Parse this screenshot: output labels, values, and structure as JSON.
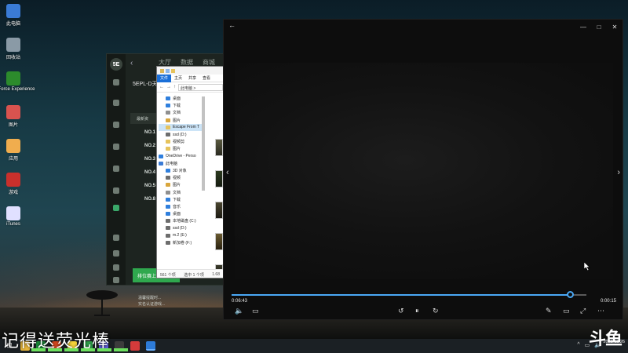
{
  "desktop": {
    "icons": [
      {
        "label": "此电脑",
        "icon": "computer-icon",
        "color": "#3a7bd5"
      },
      {
        "label": "回收站",
        "icon": "recycle-bin-icon",
        "color": "#8a9aa6"
      },
      {
        "label": "GeForce Experience",
        "icon": "nvidia-icon",
        "color": "#2c8b2c"
      },
      {
        "label": "图片",
        "icon": "pictures-folder-icon",
        "color": "#d9534f"
      },
      {
        "label": "应用",
        "icon": "apps-icon",
        "color": "#f0ad4e"
      },
      {
        "label": "游戏",
        "icon": "game-icon",
        "color": "#c9302c"
      },
      {
        "label": "iTunes",
        "icon": "itunes-icon",
        "color": "#e0e0ff"
      }
    ]
  },
  "game_client": {
    "logo": "5E",
    "tabs": [
      "大厅",
      "数据",
      "商城"
    ],
    "title": "5EPL-D天",
    "header_label": "最新资",
    "ranks": [
      "NO.1",
      "NO.2",
      "NO.3",
      "NO.4",
      "NO.5",
      "NO.8"
    ],
    "green_button": "排位赛上榜",
    "notice_lines": [
      "温馨提醒时...",
      "实名认证游戏..."
    ]
  },
  "explorer": {
    "ribbon_tabs": [
      "文件",
      "主页",
      "共享",
      "查看"
    ],
    "address": "此电脑 >",
    "nav_items": [
      {
        "label": "桌面",
        "icon_color": "#2f7fdd",
        "indent": true
      },
      {
        "label": "下载",
        "icon_color": "#2f7fdd",
        "indent": true
      },
      {
        "label": "文档",
        "icon_color": "#8f8f8f",
        "indent": true
      },
      {
        "label": "图片",
        "icon_color": "#d9a63c",
        "indent": true
      },
      {
        "label": "Escape From T",
        "icon_color": "#e6c35c",
        "indent": true,
        "selected": true
      },
      {
        "label": "ssd (D:)",
        "icon_color": "#6d6d6d",
        "indent": true
      },
      {
        "label": "视频剪",
        "icon_color": "#e6c35c",
        "indent": true
      },
      {
        "label": "图片",
        "icon_color": "#e6c35c",
        "indent": true
      },
      {
        "label": "OneDrive - Perso",
        "icon_color": "#2f7fdd",
        "indent": false
      },
      {
        "label": "此电脑",
        "icon_color": "#3a7bd5",
        "indent": false
      },
      {
        "label": "3D 对象",
        "icon_color": "#2f7fdd",
        "indent": true
      },
      {
        "label": "视频",
        "icon_color": "#6d6d6d",
        "indent": true
      },
      {
        "label": "图片",
        "icon_color": "#d9a63c",
        "indent": true
      },
      {
        "label": "文档",
        "icon_color": "#8f8f8f",
        "indent": true
      },
      {
        "label": "下载",
        "icon_color": "#2f7fdd",
        "indent": true
      },
      {
        "label": "音乐",
        "icon_color": "#2f7fdd",
        "indent": true
      },
      {
        "label": "桌面",
        "icon_color": "#2f7fdd",
        "indent": true
      },
      {
        "label": "本地磁盘 (C:)",
        "icon_color": "#6d6d6d",
        "indent": true
      },
      {
        "label": "ssd (D:)",
        "icon_color": "#6d6d6d",
        "indent": true
      },
      {
        "label": "m.2 (E:)",
        "icon_color": "#6d6d6d",
        "indent": true
      },
      {
        "label": "新加卷 (F:)",
        "icon_color": "#6d6d6d",
        "indent": true
      }
    ],
    "status": [
      "561 个项目",
      "选中 1 个项目",
      "1.68"
    ]
  },
  "player": {
    "elapsed": "0:06:43",
    "remaining": "0:00:15",
    "progress": 0.955,
    "accent": "#4aa8f5",
    "controls_left": [
      {
        "name": "volume-icon",
        "glyph": "🔈"
      },
      {
        "name": "subtitles-icon",
        "glyph": "▭"
      }
    ],
    "controls_center": [
      {
        "name": "rewind-10-icon",
        "glyph": "↺"
      },
      {
        "name": "pause-icon",
        "glyph": "⏸"
      },
      {
        "name": "forward-30-icon",
        "glyph": "↻"
      }
    ],
    "controls_right": [
      {
        "name": "edit-icon",
        "glyph": "✎"
      },
      {
        "name": "mini-view-icon",
        "glyph": "▭"
      },
      {
        "name": "fullscreen-icon",
        "glyph": "⤢"
      },
      {
        "name": "more-icon",
        "glyph": "⋯"
      }
    ]
  },
  "taskbar": {
    "date": "2022/12/26",
    "watermark": "斗鱼"
  },
  "overlay_caption": "记得送荧光棒"
}
